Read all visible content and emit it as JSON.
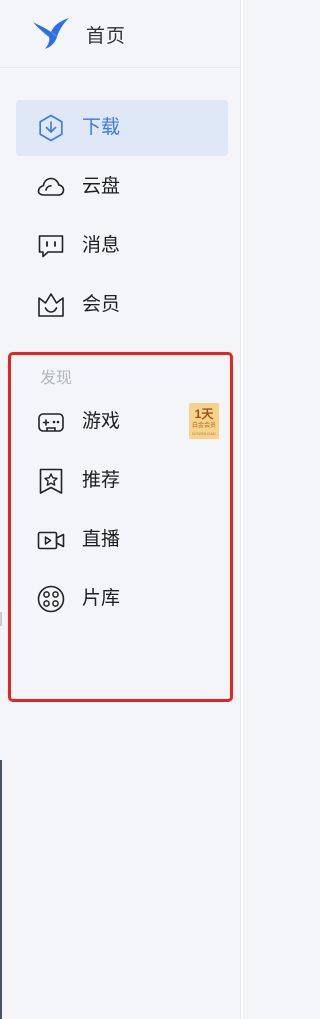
{
  "header": {
    "title": "首页",
    "logo_icon": "bird-logo-icon",
    "logo_color": "#2f6fe4"
  },
  "nav": {
    "items": [
      {
        "label": "下载",
        "icon": "download-icon",
        "active": true
      },
      {
        "label": "云盘",
        "icon": "cloud-icon",
        "active": false
      },
      {
        "label": "消息",
        "icon": "message-icon",
        "active": false
      },
      {
        "label": "会员",
        "icon": "crown-icon",
        "active": false
      }
    ]
  },
  "discover": {
    "section_label": "发现",
    "items": [
      {
        "label": "游戏",
        "icon": "gamepad-icon"
      },
      {
        "label": "推荐",
        "icon": "bookmark-star-icon"
      },
      {
        "label": "直播",
        "icon": "video-camera-icon"
      },
      {
        "label": "片库",
        "icon": "film-reel-icon"
      }
    ],
    "game_badge": {
      "main": "1天",
      "sub": "白金会员",
      "sub2": "DOWNLOAD"
    }
  },
  "colors": {
    "accent": "#3c78e8",
    "active_bg": "#dfe8f7",
    "highlight_border": "#e8221c",
    "sidebar_bg": "#f3f5f8"
  }
}
